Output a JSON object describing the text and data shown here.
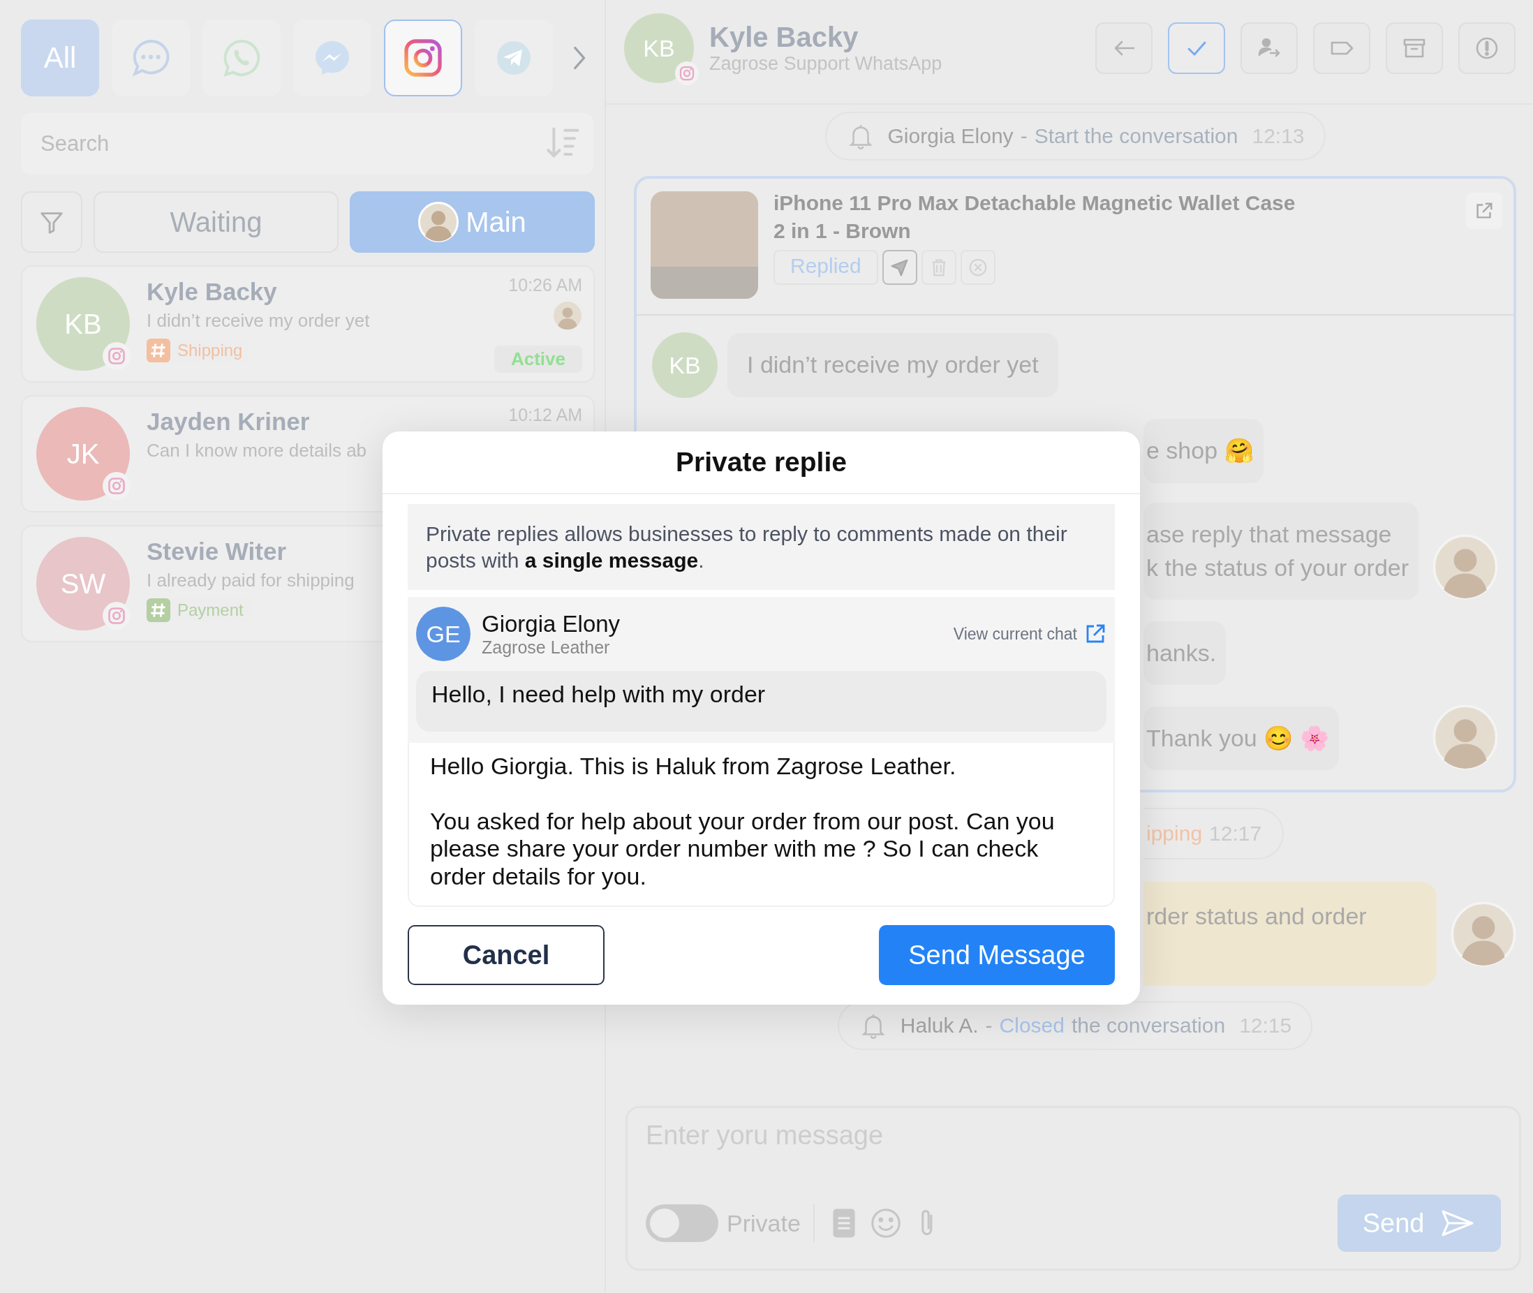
{
  "channel_tabs": [
    {
      "kind": "all",
      "label": "All",
      "selected": true
    },
    {
      "kind": "chat",
      "selected": false
    },
    {
      "kind": "whatsapp",
      "selected": false
    },
    {
      "kind": "messenger",
      "selected": false
    },
    {
      "kind": "instagram",
      "selected": true
    },
    {
      "kind": "telegram",
      "selected": false
    }
  ],
  "search": {
    "placeholder": "Search"
  },
  "filter_tabs": [
    {
      "kind": "status",
      "label": "Waiting",
      "selected": false
    },
    {
      "kind": "agent",
      "label": "Main",
      "selected": true
    }
  ],
  "conversations": [
    {
      "initials": "KB",
      "color": "#cfdcc4",
      "name": "Kyle Backy",
      "preview": "I didn’t receive my order yet",
      "time": "10:26 AM",
      "assigned": true,
      "tag": {
        "label": "Shipping",
        "color": "#f3bfa0"
      },
      "status": "Active"
    },
    {
      "initials": "JK",
      "color": "#ebb9b8",
      "name": "Jayden Kriner",
      "preview": "Can I know more details ab",
      "time": "10:12 AM"
    },
    {
      "initials": "SW",
      "color": "#e7c5c8",
      "name": "Stevie Witer",
      "preview": "I already paid for shipping",
      "tag": {
        "label": "Payment",
        "color": "#b4cfa2"
      }
    }
  ],
  "chat_header": {
    "initials": "KB",
    "color": "#cfdcc4",
    "name": "Kyle Backy",
    "subtitle": "Zagrose Support WhatsApp"
  },
  "header_actions": [
    {
      "kind": "back",
      "selected": false
    },
    {
      "kind": "resolve",
      "selected": true
    },
    {
      "kind": "assign",
      "selected": false
    },
    {
      "kind": "label",
      "selected": false
    },
    {
      "kind": "archive",
      "selected": false
    },
    {
      "kind": "block",
      "selected": false
    }
  ],
  "timeline": [
    {
      "kind": "event",
      "actor": "Giorgia Elony",
      "separator": "-",
      "action": "Start the conversation",
      "time": "12:13"
    },
    {
      "kind": "post",
      "product": {
        "title": "iPhone 11 Pro Max Detachable Magnetic Wallet Case",
        "subtitle": "2 in 1 - Brown",
        "status": "Replied",
        "actions": [
          {
            "kind": "send",
            "disabled": false
          },
          {
            "kind": "delete",
            "disabled": true
          },
          {
            "kind": "dismiss",
            "disabled": true
          }
        ]
      },
      "messages": [
        {
          "kind": "incoming",
          "initials": "KB",
          "color": "#cfdcc4",
          "text": "I didn’t receive my order yet"
        },
        {
          "kind": "outgoing",
          "text": "e shop 🤗",
          "avatar": false
        },
        {
          "kind": "outgoing",
          "text": "ase reply that message\nk the status of your order",
          "avatar": true
        },
        {
          "kind": "outgoing",
          "text": "hanks.",
          "avatar": false
        },
        {
          "kind": "outgoing",
          "text": "Thank you 😊 🌸",
          "avatar": true
        }
      ]
    },
    {
      "kind": "tag_event",
      "label": "ipping",
      "time": "12:17"
    },
    {
      "kind": "note",
      "text": "rder status and order",
      "avatar": true
    },
    {
      "kind": "event",
      "actor": "Haluk A.",
      "separator": "-",
      "status": "Closed",
      "action": "the conversation",
      "time": "12:15"
    }
  ],
  "composer": {
    "placeholder": "Enter yoru message",
    "private": {
      "label": "Private",
      "on": false
    },
    "tools": [
      {
        "kind": "template"
      },
      {
        "kind": "emoji"
      },
      {
        "kind": "attach"
      }
    ],
    "send": {
      "label": "Send",
      "disabled": true
    }
  },
  "modal": {
    "title": "Private replie",
    "info": "Private replies allows businesses to reply to comments made on their posts with **a single message**.",
    "comment": {
      "initials": "GE",
      "color": "#5e95e3",
      "name": "Giorgia Elony",
      "page": "Zagrose Leather",
      "link": "View current chat",
      "text": "Hello, I need help with my order"
    },
    "reply": "Hello Giorgia. This is Haluk from Zagrose Leather.\n\nYou asked for help about your order from our post. Can you please share your order number with me ? So I can check order details for you.",
    "buttons": [
      {
        "kind": "secondary",
        "label": "Cancel"
      },
      {
        "kind": "primary",
        "label": "Send Message"
      }
    ]
  }
}
